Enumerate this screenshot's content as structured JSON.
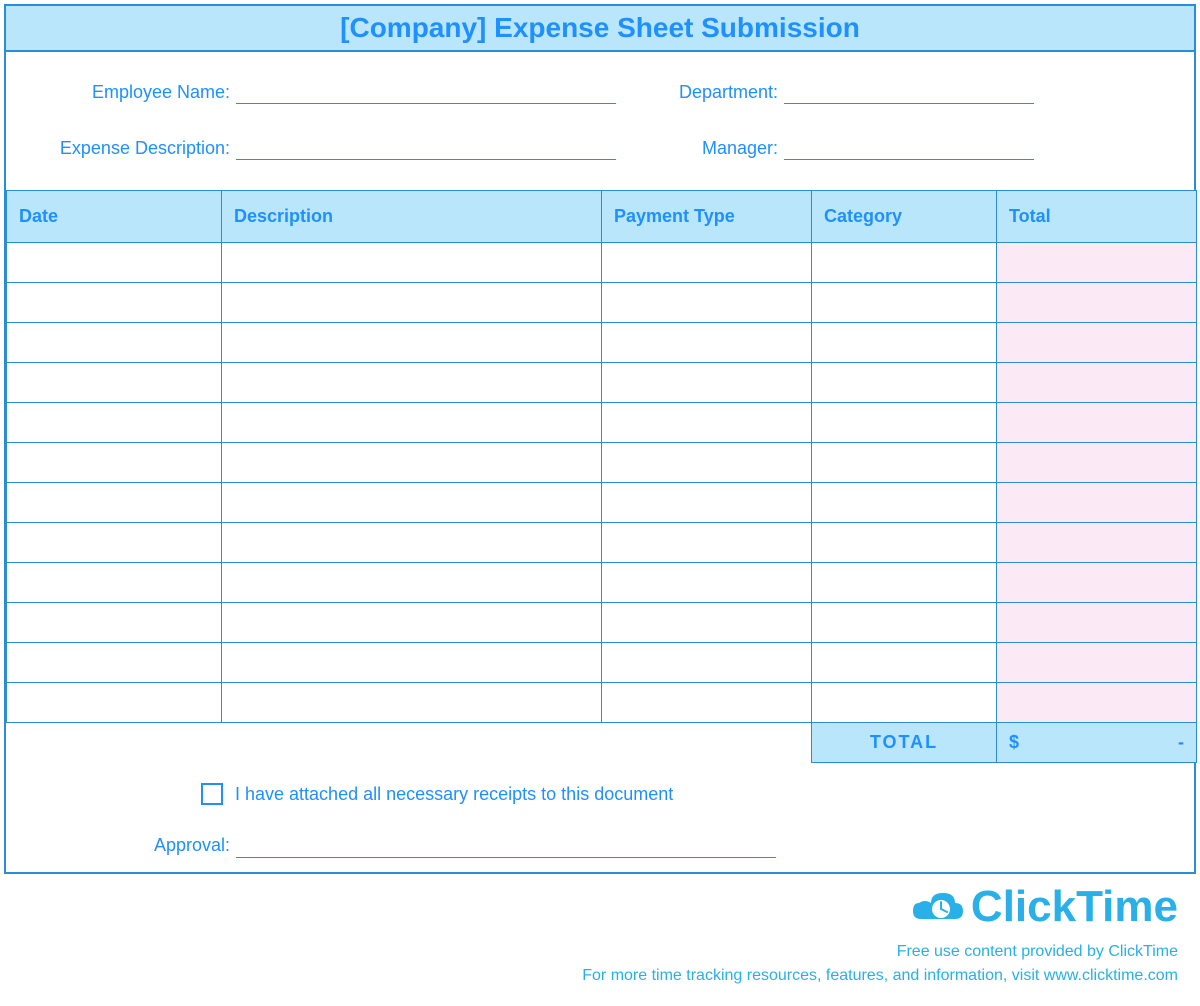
{
  "title": "[Company] Expense Sheet Submission",
  "fields": {
    "employee_name": {
      "label": "Employee Name:",
      "value": ""
    },
    "department": {
      "label": "Department:",
      "value": ""
    },
    "expense_desc": {
      "label": "Expense Description:",
      "value": ""
    },
    "manager": {
      "label": "Manager:",
      "value": ""
    },
    "approval": {
      "label": "Approval:",
      "value": ""
    }
  },
  "attestation": "I have attached all necessary receipts to this document",
  "columns": {
    "date": "Date",
    "description": "Description",
    "payment_type": "Payment Type",
    "category": "Category",
    "total": "Total"
  },
  "rows": [
    {
      "date": "",
      "description": "",
      "payment_type": "",
      "category": "",
      "total": ""
    },
    {
      "date": "",
      "description": "",
      "payment_type": "",
      "category": "",
      "total": ""
    },
    {
      "date": "",
      "description": "",
      "payment_type": "",
      "category": "",
      "total": ""
    },
    {
      "date": "",
      "description": "",
      "payment_type": "",
      "category": "",
      "total": ""
    },
    {
      "date": "",
      "description": "",
      "payment_type": "",
      "category": "",
      "total": ""
    },
    {
      "date": "",
      "description": "",
      "payment_type": "",
      "category": "",
      "total": ""
    },
    {
      "date": "",
      "description": "",
      "payment_type": "",
      "category": "",
      "total": ""
    },
    {
      "date": "",
      "description": "",
      "payment_type": "",
      "category": "",
      "total": ""
    },
    {
      "date": "",
      "description": "",
      "payment_type": "",
      "category": "",
      "total": ""
    },
    {
      "date": "",
      "description": "",
      "payment_type": "",
      "category": "",
      "total": ""
    },
    {
      "date": "",
      "description": "",
      "payment_type": "",
      "category": "",
      "total": ""
    },
    {
      "date": "",
      "description": "",
      "payment_type": "",
      "category": "",
      "total": ""
    }
  ],
  "grand_total": {
    "label": "TOTAL",
    "currency": "$",
    "amount": "-"
  },
  "brand": {
    "name": "ClickTime",
    "line1": "Free use content provided by ClickTime",
    "line2": "For more time tracking resources, features, and information, visit www.clicktime.com"
  }
}
